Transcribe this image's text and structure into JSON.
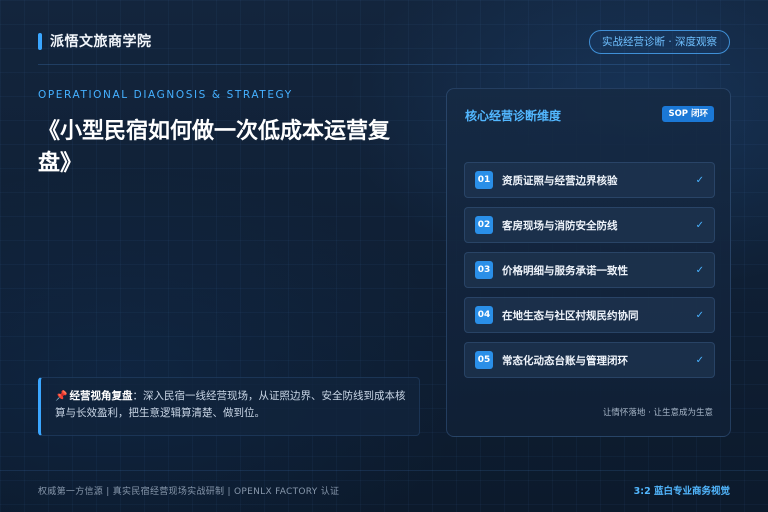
{
  "header": {
    "brand": "派悟文旅商学院",
    "pill": "实战经营诊断 · 深度观察"
  },
  "kicker": "OPERATIONAL DIAGNOSIS & STRATEGY",
  "title": "《小型民宿如何做一次低成本运营复盘》",
  "note": {
    "icon": "pin-icon",
    "head": "经营视角复盘",
    "body": "：深入民宿一线经营现场，从证照边界、安全防线到成本核算与长效盈利，把生意逻辑算清楚、做到位。"
  },
  "card": {
    "title": "核心经营诊断维度",
    "badge": "SOP 闭环",
    "items": [
      {
        "num": "01",
        "label": "资质证照与经营边界核验"
      },
      {
        "num": "02",
        "label": "客房现场与消防安全防线"
      },
      {
        "num": "03",
        "label": "价格明细与服务承诺一致性"
      },
      {
        "num": "04",
        "label": "在地生态与社区村规民约协同"
      },
      {
        "num": "05",
        "label": "常态化动态台账与管理闭环"
      }
    ],
    "check": "✓",
    "footer": "让情怀落地 · 让生意成为生意"
  },
  "footer": {
    "left": "权威第一方信源 | 真实民宿经营现场实战研制 | OPENLX FACTORY 认证",
    "right": "3:2 蓝白专业商务视觉"
  },
  "colors": {
    "accent": "#3aa6ff",
    "background": "#0f2036",
    "pin": "#ff5a5a"
  }
}
